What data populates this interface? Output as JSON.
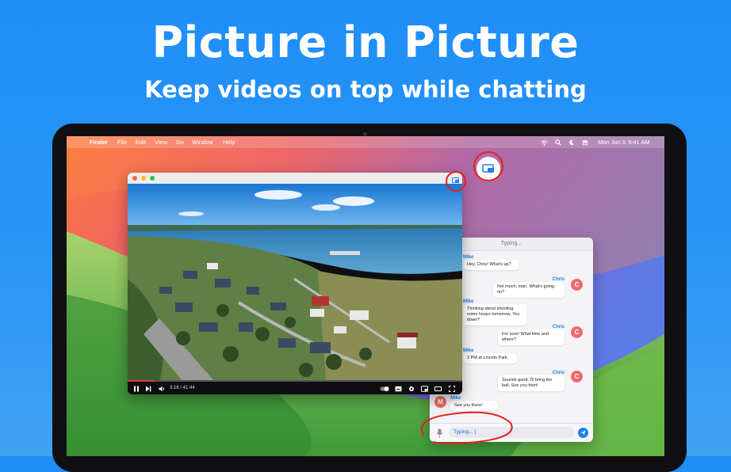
{
  "headline": {
    "title": "Picture in Picture",
    "subtitle": "Keep videos on top while chatting"
  },
  "menubar": {
    "app": "Finder",
    "items": [
      "File",
      "Edit",
      "View",
      "Go",
      "Window",
      "Help"
    ],
    "date": "Mon Jun 6",
    "time": "9:41 AM"
  },
  "video": {
    "time": "3:16 / 41:44",
    "progress": 0.08
  },
  "chat": {
    "header": "Typing...",
    "messages": [
      {
        "sender": "Mike",
        "text": "Hey, Chris! What's up?",
        "side": "left"
      },
      {
        "sender": "Chris",
        "text": "Not much, man. What's going on?",
        "side": "right",
        "avatar": "C"
      },
      {
        "sender": "Mike",
        "text": "Thinking about shooting some hoops tomorrow. You down?",
        "side": "left"
      },
      {
        "sender": "Chris",
        "text": "For sure! What time and where?",
        "side": "right",
        "avatar": "C"
      },
      {
        "sender": "Mike",
        "text": "3 PM at Lincoln Park.",
        "side": "left"
      },
      {
        "sender": "Chris",
        "text": "Sounds good. I'll bring the ball. See you then!",
        "side": "right",
        "avatar": "C"
      },
      {
        "sender": "Mike",
        "text": "See you there!",
        "side": "left",
        "avatar": "M"
      }
    ],
    "input_value": "Typing... |"
  },
  "colors": {
    "accent": "#1e7ef0",
    "annotation": "#e0241e",
    "avatar": "#ea6b6b"
  }
}
